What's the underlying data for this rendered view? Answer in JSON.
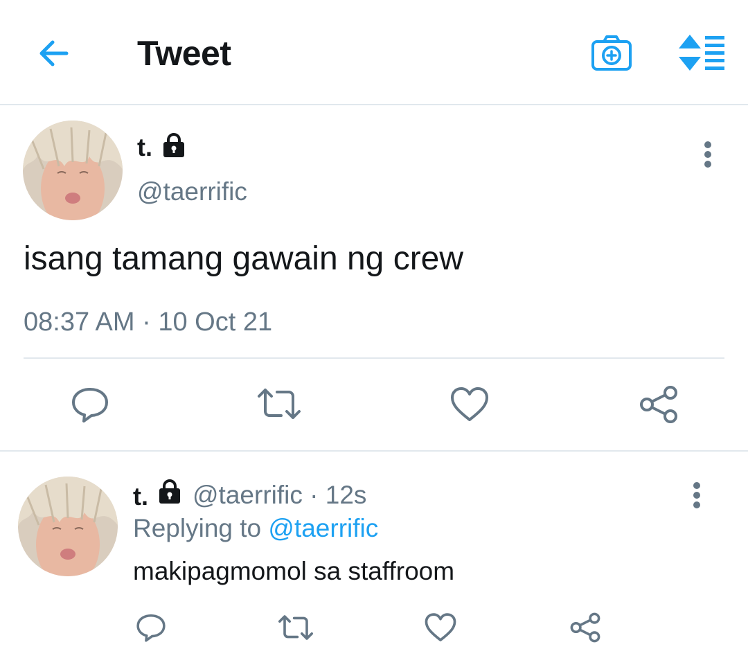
{
  "header": {
    "title": "Tweet"
  },
  "main_tweet": {
    "name": "t.",
    "handle": "@taerrific",
    "text": "isang tamang gawain ng crew",
    "timestamp": "08:37 AM · 10 Oct 21"
  },
  "reply": {
    "name": "t.",
    "handle": "@taerrific",
    "separator": "·",
    "age": "12s",
    "replying_prefix": "Replying to",
    "replying_handle": "@taerrific",
    "text": "makipagmomol sa staffroom"
  },
  "colors": {
    "accent": "#1da1f2",
    "icon_gray": "#657786",
    "divider": "#e1e8ed"
  }
}
